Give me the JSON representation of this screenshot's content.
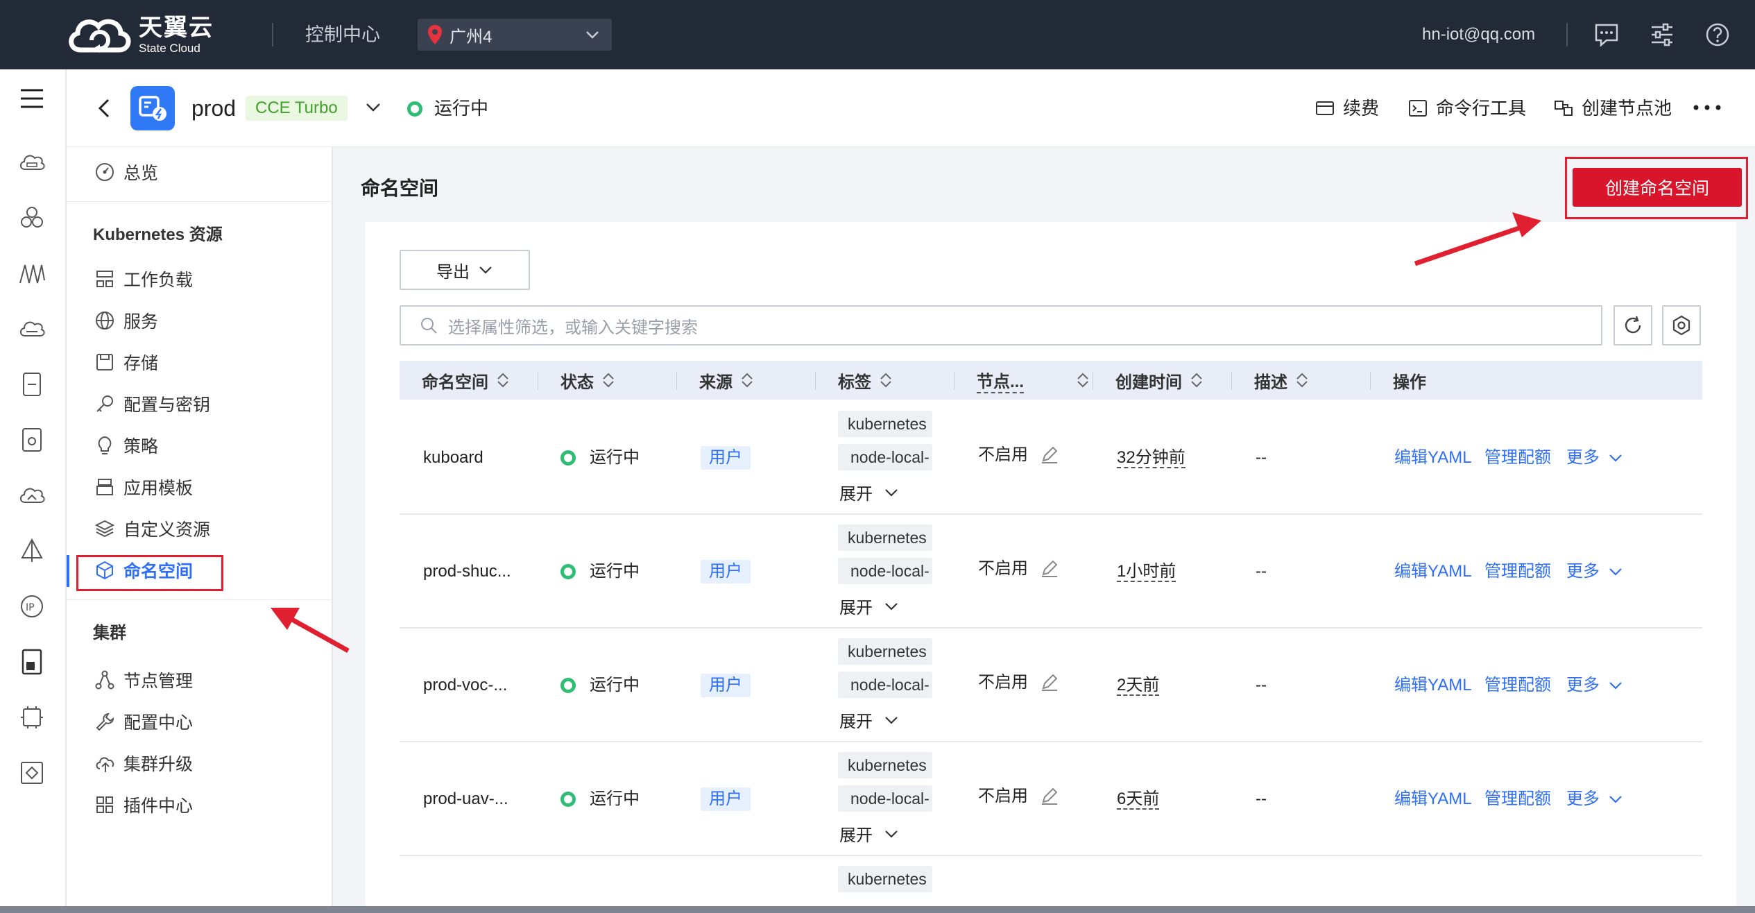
{
  "topbar": {
    "brand_cn": "天翼云",
    "brand_en": "State Cloud",
    "console": "控制中心",
    "region": "广州4",
    "email": "hn-iot@qq.com",
    "icons": [
      "message-icon",
      "settings-sliders-icon",
      "help-icon"
    ]
  },
  "cluster": {
    "name": "prod",
    "type_tag": "CCE Turbo",
    "status": "运行中",
    "actions": {
      "renew": "续费",
      "cli": "命令行工具",
      "create_pool": "创建节点池"
    }
  },
  "sidebar": {
    "overview": "总览",
    "group_k8s": "Kubernetes 资源",
    "k8s_items": [
      "工作负载",
      "服务",
      "存储",
      "配置与密钥",
      "策略",
      "应用模板",
      "自定义资源",
      "命名空间"
    ],
    "group_cluster": "集群",
    "cluster_items": [
      "节点管理",
      "配置中心",
      "集群升级",
      "插件中心"
    ]
  },
  "main": {
    "title": "命名空间",
    "create_button": "创建命名空间",
    "export_button": "导出",
    "search_placeholder": "选择属性筛选，或输入关键字搜索"
  },
  "table": {
    "columns": [
      "命名空间",
      "状态",
      "来源",
      "标签",
      "节点...",
      "创建时间",
      "描述",
      "操作"
    ],
    "rows": [
      {
        "name": "kuboard",
        "status": "运行中",
        "source": "用户",
        "labels": [
          "kubernetes",
          "node-local-"
        ],
        "expand": "展开",
        "node": "不启用",
        "created": "32分钟前",
        "desc": "--",
        "ops": [
          "编辑YAML",
          "管理配额",
          "更多"
        ]
      },
      {
        "name": "prod-shuc...",
        "status": "运行中",
        "source": "用户",
        "labels": [
          "kubernetes",
          "node-local-"
        ],
        "expand": "展开",
        "node": "不启用",
        "created": "1小时前",
        "desc": "--",
        "ops": [
          "编辑YAML",
          "管理配额",
          "更多"
        ]
      },
      {
        "name": "prod-voc-...",
        "status": "运行中",
        "source": "用户",
        "labels": [
          "kubernetes",
          "node-local-"
        ],
        "expand": "展开",
        "node": "不启用",
        "created": "2天前",
        "desc": "--",
        "ops": [
          "编辑YAML",
          "管理配额",
          "更多"
        ]
      },
      {
        "name": "prod-uav-...",
        "status": "运行中",
        "source": "用户",
        "labels": [
          "kubernetes",
          "node-local-"
        ],
        "expand": "展开",
        "node": "不启用",
        "created": "6天前",
        "desc": "--",
        "ops": [
          "编辑YAML",
          "管理配额",
          "更多"
        ]
      },
      {
        "labels": [
          "kubernetes"
        ]
      }
    ]
  },
  "colors": {
    "topbar_bg": "#232a37",
    "primary_blue": "#2f6ff6",
    "create_red": "#d9152b",
    "status_green": "#2dbe74",
    "annotation_red": "#e02030"
  }
}
